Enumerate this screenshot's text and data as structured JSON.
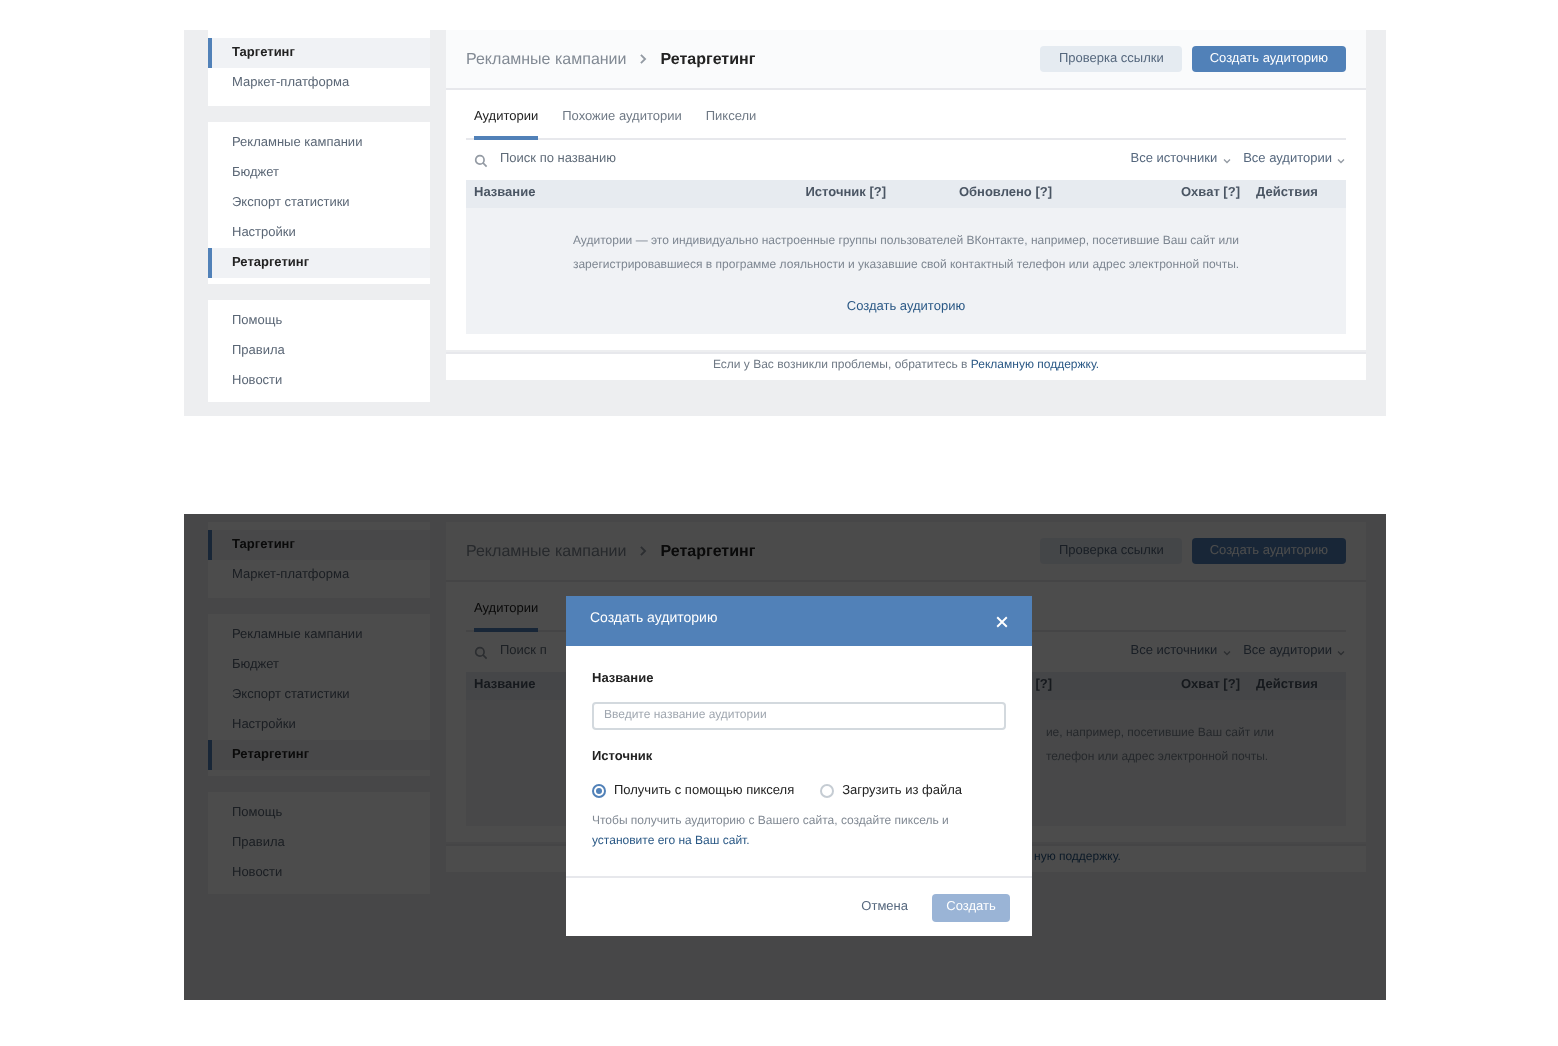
{
  "top_screen": {
    "sidebar": {
      "groups": [
        {
          "items": [
            {
              "label": "Таргетинг",
              "selected": true
            },
            {
              "label": "Маркет-платформа",
              "selected": false
            }
          ]
        },
        {
          "items": [
            {
              "label": "Рекламные кампании",
              "selected": false
            },
            {
              "label": "Бюджет",
              "selected": false
            },
            {
              "label": "Экспорт статистики",
              "selected": false
            },
            {
              "label": "Настройки",
              "selected": false
            },
            {
              "label": "Ретаргетинг",
              "selected": true
            }
          ]
        },
        {
          "items": [
            {
              "label": "Помощь",
              "selected": false
            },
            {
              "label": "Правила",
              "selected": false
            },
            {
              "label": "Новости",
              "selected": false
            }
          ]
        }
      ]
    },
    "breadcrumb": {
      "parent": "Рекламные кампании",
      "current": "Ретаргетинг"
    },
    "buttons": [
      {
        "label": "Проверка ссылки",
        "kind": "secondary"
      },
      {
        "label": "Создать аудиторию",
        "kind": "primary"
      }
    ],
    "tabs": [
      {
        "label": "Аудитории",
        "selected": true
      },
      {
        "label": "Похожие аудитории",
        "selected": false
      },
      {
        "label": "Пиксели",
        "selected": false
      }
    ],
    "search": {
      "placeholder": "Поиск по названию"
    },
    "filters": [
      "Все источники",
      "Все аудитории"
    ],
    "columns": {
      "name": "Название",
      "source": "Источник [?]",
      "updated": "Обновлено [?]",
      "reach": "Охват [?]",
      "actions": "Действия"
    },
    "empty_text": "Аудитории — это индивидуально настроенные группы пользователей ВКонтакте, например, посетившие Ваш сайт или зарегистрировавшиеся в программе лояльности и указавшие свой контактный телефон или адрес электронной почты.",
    "empty_link": "Создать аудиторию",
    "footer": {
      "text": "Если у Вас возникли проблемы, обратитесь в ",
      "link": "Рекламную поддержку."
    }
  },
  "bottom_screen": {
    "sidebar": {
      "groups": [
        {
          "items": [
            {
              "label": "Таргетинг",
              "selected": true
            },
            {
              "label": "Маркет-платформа",
              "selected": false
            }
          ]
        },
        {
          "items": [
            {
              "label": "Рекламные кампании",
              "selected": false
            },
            {
              "label": "Бюджет",
              "selected": false
            },
            {
              "label": "Экспорт статистики",
              "selected": false
            },
            {
              "label": "Настройки",
              "selected": false
            },
            {
              "label": "Ретаргетинг",
              "selected": true
            }
          ]
        },
        {
          "items": [
            {
              "label": "Помощь",
              "selected": false
            },
            {
              "label": "Правила",
              "selected": false
            },
            {
              "label": "Новости",
              "selected": false
            }
          ]
        }
      ]
    },
    "breadcrumb": {
      "parent": "Рекламные кампании",
      "current": "Ретаргетинг"
    },
    "buttons": [
      {
        "label": "Проверка ссылки",
        "kind": "secondary"
      },
      {
        "label": "Создать аудиторию",
        "kind": "primary"
      }
    ],
    "tabs": [
      {
        "label": "Аудитории",
        "selected": true
      }
    ],
    "search": {
      "placeholder": "Поиск п"
    },
    "filters": [
      "Все источники",
      "Все аудитории"
    ],
    "columns": {
      "name": "Название",
      "updated": "[?]",
      "reach": "Охват [?]",
      "actions": "Действия"
    },
    "empty_text_fragments": [
      "ие, например, посетившие Ваш сайт или",
      "телефон или адрес электронной почты."
    ],
    "footer": {
      "link": "ную поддержку."
    },
    "dialog": {
      "title": "Создать аудиторию",
      "name_label": "Название",
      "name_field": {
        "placeholder": "Введите название аудитории"
      },
      "source_label": "Источник",
      "sources": [
        {
          "label": "Получить с помощью пикселя",
          "selected": true
        },
        {
          "label": "Загрузить из файла",
          "selected": false
        }
      ],
      "help": {
        "text": "Чтобы получить аудиторию с Вашего сайта, создайте пиксель и ",
        "link": "установите его на Ваш сайт."
      },
      "cancel": "Отмена",
      "submit": {
        "label": "Создать",
        "disabled": true
      }
    }
  }
}
